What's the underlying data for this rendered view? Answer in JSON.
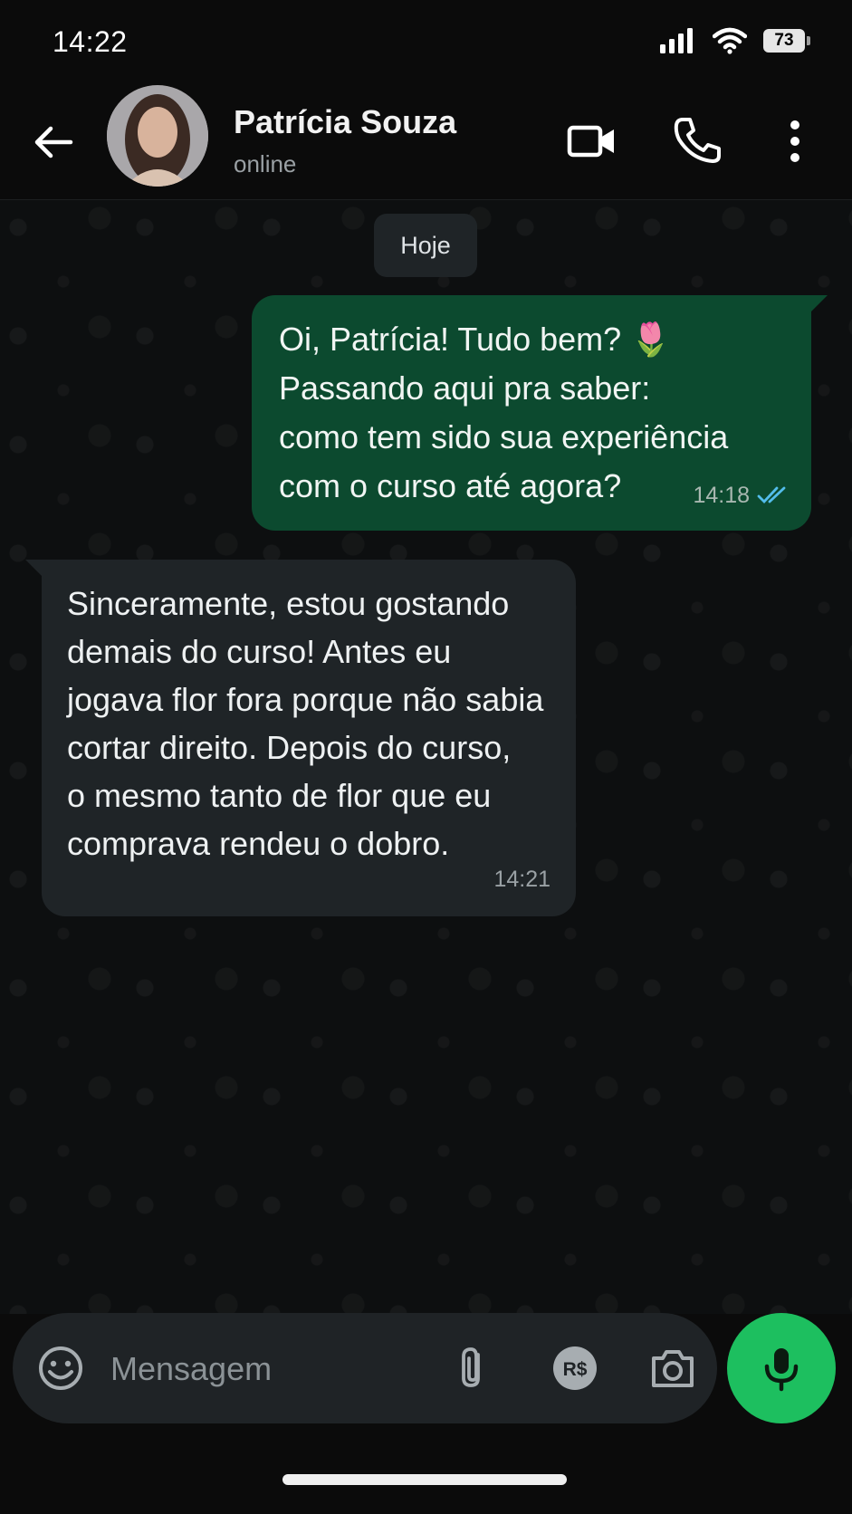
{
  "status_bar": {
    "time": "14:22",
    "battery": "73"
  },
  "header": {
    "contact_name": "Patrícia Souza",
    "contact_status": "online"
  },
  "chat": {
    "date_label": "Hoje",
    "messages": [
      {
        "direction": "outgoing",
        "lines": [
          "Oi, Patrícia! Tudo bem? 🌷",
          "Passando aqui pra saber:",
          "como tem sido sua experiência",
          "com o curso até agora?"
        ],
        "time": "14:18",
        "read": true
      },
      {
        "direction": "incoming",
        "lines": [
          "Sinceramente, estou gostando",
          "demais do curso! Antes eu",
          "jogava flor fora porque não sabia",
          "cortar direito. Depois do curso,",
          "o mesmo tanto de flor que eu",
          "comprava rendeu o dobro."
        ],
        "time": "14:21"
      }
    ]
  },
  "composer": {
    "placeholder": "Mensagem",
    "payment_icon_text": "R$"
  },
  "colors": {
    "outgoing_bubble": "#0c4a2f",
    "incoming_bubble": "#1f2427",
    "accent": "#1dbf5f",
    "read_ticks": "#53bdeb"
  },
  "icons": [
    "back-arrow-icon",
    "video-camera-icon",
    "phone-icon",
    "more-vertical-icon",
    "emoji-icon",
    "paperclip-icon",
    "payment-icon",
    "camera-icon",
    "microphone-icon",
    "double-check-icon"
  ]
}
